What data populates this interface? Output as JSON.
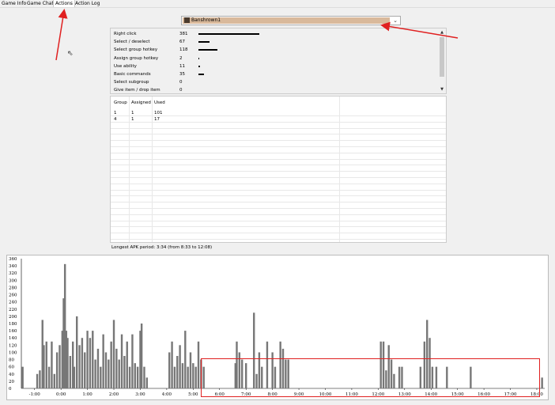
{
  "tabs": [
    "Game Info",
    "Game Chat",
    "Actions",
    "Action Log"
  ],
  "active_tab": "Actions",
  "player": {
    "name": "Banshrown1"
  },
  "actions": [
    {
      "name": "Right click",
      "value": 381,
      "bar": 1.0
    },
    {
      "name": "Select / deselect",
      "value": 67,
      "bar": 0.18
    },
    {
      "name": "Select group hotkey",
      "value": 118,
      "bar": 0.31
    },
    {
      "name": "Assign group hotkey",
      "value": 2,
      "bar": 0.0
    },
    {
      "name": "Use ability",
      "value": 11,
      "bar": 0.03
    },
    {
      "name": "Basic commands",
      "value": 35,
      "bar": 0.09
    },
    {
      "name": "Select subgroup",
      "value": 0,
      "bar": 0.0
    },
    {
      "name": "Give item / drop item",
      "value": 0,
      "bar": 0.0
    }
  ],
  "groups": {
    "headers": [
      "Group",
      "Assigned",
      "Used"
    ],
    "rows": [
      [
        "1",
        "1",
        "101"
      ],
      [
        "4",
        "1",
        "17"
      ]
    ]
  },
  "longest_apk": "Longest APK period: 3:34 (from 8:33 to 12:08)",
  "colors": {
    "highlight": "#e02020",
    "bar": "#777777"
  },
  "chart_data": {
    "type": "bar",
    "y_ticks": [
      "360",
      "340",
      "320",
      "300",
      "280",
      "260",
      "240",
      "220",
      "200",
      "180",
      "160",
      "140",
      "120",
      "100",
      "80",
      "60",
      "40",
      "20",
      "0"
    ],
    "x_ticks": [
      "-1:00",
      "0:00",
      "1:00",
      "2:00",
      "3:00",
      "4:00",
      "5:00",
      "6:00",
      "7:00",
      "8:00",
      "9:00",
      "10:00",
      "11:00",
      "12:00",
      "13:00",
      "14:00",
      "15:00",
      "16:00",
      "17:00",
      "18:00"
    ],
    "ylim": [
      0,
      360
    ],
    "xlim": [
      -1.5,
      18.3
    ],
    "series": [
      {
        "values": [
          [
            -1.45,
            60
          ],
          [
            -0.9,
            40
          ],
          [
            -0.8,
            50
          ],
          [
            -0.7,
            190
          ],
          [
            -0.65,
            120
          ],
          [
            -0.55,
            130
          ],
          [
            -0.45,
            60
          ],
          [
            -0.35,
            130
          ],
          [
            -0.25,
            40
          ],
          [
            -0.15,
            100
          ],
          [
            -0.05,
            120
          ],
          [
            0.05,
            160
          ],
          [
            0.1,
            250
          ],
          [
            0.15,
            345
          ],
          [
            0.2,
            160
          ],
          [
            0.25,
            140
          ],
          [
            0.35,
            90
          ],
          [
            0.45,
            130
          ],
          [
            0.5,
            60
          ],
          [
            0.6,
            200
          ],
          [
            0.7,
            120
          ],
          [
            0.8,
            140
          ],
          [
            0.9,
            100
          ],
          [
            1.0,
            160
          ],
          [
            1.1,
            140
          ],
          [
            1.2,
            160
          ],
          [
            1.3,
            80
          ],
          [
            1.4,
            110
          ],
          [
            1.5,
            60
          ],
          [
            1.6,
            150
          ],
          [
            1.7,
            100
          ],
          [
            1.8,
            80
          ],
          [
            1.9,
            130
          ],
          [
            2.0,
            190
          ],
          [
            2.1,
            110
          ],
          [
            2.2,
            80
          ],
          [
            2.3,
            150
          ],
          [
            2.4,
            90
          ],
          [
            2.5,
            130
          ],
          [
            2.6,
            60
          ],
          [
            2.7,
            150
          ],
          [
            2.8,
            70
          ],
          [
            2.9,
            60
          ],
          [
            3.0,
            160
          ],
          [
            3.05,
            180
          ],
          [
            3.15,
            60
          ],
          [
            3.25,
            30
          ],
          [
            4.1,
            100
          ],
          [
            4.2,
            130
          ],
          [
            4.3,
            60
          ],
          [
            4.4,
            90
          ],
          [
            4.5,
            120
          ],
          [
            4.6,
            70
          ],
          [
            4.7,
            160
          ],
          [
            4.8,
            60
          ],
          [
            4.9,
            100
          ],
          [
            5.0,
            70
          ],
          [
            5.1,
            60
          ],
          [
            5.2,
            130
          ],
          [
            5.3,
            80
          ],
          [
            5.4,
            60
          ],
          [
            6.6,
            70
          ],
          [
            6.65,
            130
          ],
          [
            6.75,
            100
          ],
          [
            6.85,
            80
          ],
          [
            7.0,
            70
          ],
          [
            7.3,
            210
          ],
          [
            7.4,
            40
          ],
          [
            7.5,
            100
          ],
          [
            7.6,
            60
          ],
          [
            7.8,
            130
          ],
          [
            8.0,
            100
          ],
          [
            8.1,
            60
          ],
          [
            8.3,
            130
          ],
          [
            8.4,
            110
          ],
          [
            8.5,
            80
          ],
          [
            8.6,
            80
          ],
          [
            12.1,
            130
          ],
          [
            12.2,
            130
          ],
          [
            12.3,
            50
          ],
          [
            12.4,
            120
          ],
          [
            12.5,
            80
          ],
          [
            12.6,
            40
          ],
          [
            12.8,
            60
          ],
          [
            12.9,
            60
          ],
          [
            13.6,
            60
          ],
          [
            13.75,
            130
          ],
          [
            13.85,
            190
          ],
          [
            13.95,
            140
          ],
          [
            14.05,
            60
          ],
          [
            14.2,
            60
          ],
          [
            14.6,
            60
          ],
          [
            15.5,
            60
          ],
          [
            18.2,
            30
          ]
        ]
      }
    ]
  }
}
